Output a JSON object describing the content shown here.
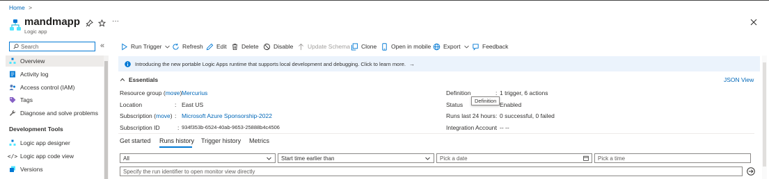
{
  "breadcrumb": {
    "home": "Home",
    "separator": ">"
  },
  "header": {
    "title": "mandmapp",
    "subtitle": "Logic app",
    "icon": "logic-app-icon",
    "more": "···"
  },
  "sidebar": {
    "search_placeholder": "Search",
    "collapse": "«",
    "items": [
      {
        "label": "Overview",
        "icon": "overview-icon",
        "selected": true
      },
      {
        "label": "Activity log",
        "icon": "activity-log-icon"
      },
      {
        "label": "Access control (IAM)",
        "icon": "iam-icon"
      },
      {
        "label": "Tags",
        "icon": "tag-icon"
      },
      {
        "label": "Diagnose and solve problems",
        "icon": "wrench-icon"
      }
    ],
    "section_title": "Development Tools",
    "dev_items": [
      {
        "label": "Logic app designer",
        "icon": "designer-icon"
      },
      {
        "label": "Logic app code view",
        "icon": "code-icon"
      },
      {
        "label": "Versions",
        "icon": "versions-icon"
      }
    ]
  },
  "toolbar": {
    "run_trigger": "Run Trigger",
    "refresh": "Refresh",
    "edit": "Edit",
    "delete": "Delete",
    "disable": "Disable",
    "update_schema": "Update Schema",
    "clone": "Clone",
    "open_mobile": "Open in mobile",
    "export": "Export",
    "feedback": "Feedback"
  },
  "banner": {
    "text": "Introducing the new portable Logic Apps runtime that supports local development and debugging. Click to learn more.",
    "arrow": "→"
  },
  "essentials": {
    "title": "Essentials",
    "json_view": "JSON View",
    "resource_group_label": "Resource group",
    "move": "move",
    "resource_group_value": "Mercurius",
    "location_label": "Location",
    "location_value": "East US",
    "subscription_label": "Subscription",
    "subscription_value": "Microsoft Azure Sponsorship-2022",
    "subscription_id_label": "Subscription ID",
    "subscription_id_value": "934f353b-6524-40ab-9653-25888b4c4506",
    "definition_label": "Definition",
    "definition_value": "1 trigger, 6 actions",
    "status_label": "Status",
    "status_value": "Enabled",
    "runs_label": "Runs last 24 hours",
    "runs_value": "0 successful, 0 failed",
    "integration_label": "Integration Account",
    "integration_value": "-- --",
    "tooltip": "Definition",
    "colon": ":"
  },
  "tabs": [
    "Get started",
    "Runs history",
    "Trigger history",
    "Metrics"
  ],
  "active_tab": "Runs history",
  "filters": {
    "status_value": "All",
    "time_value": "Start time earlier than",
    "date_placeholder": "Pick a date",
    "time_placeholder": "Pick a time",
    "run_id_placeholder": "Specify the run identifier to open monitor view directly"
  },
  "colors": {
    "accent": "#0078d4",
    "link": "#0067b8",
    "banner_bg": "#ebf3fc",
    "selected_bg": "#edebe9"
  }
}
